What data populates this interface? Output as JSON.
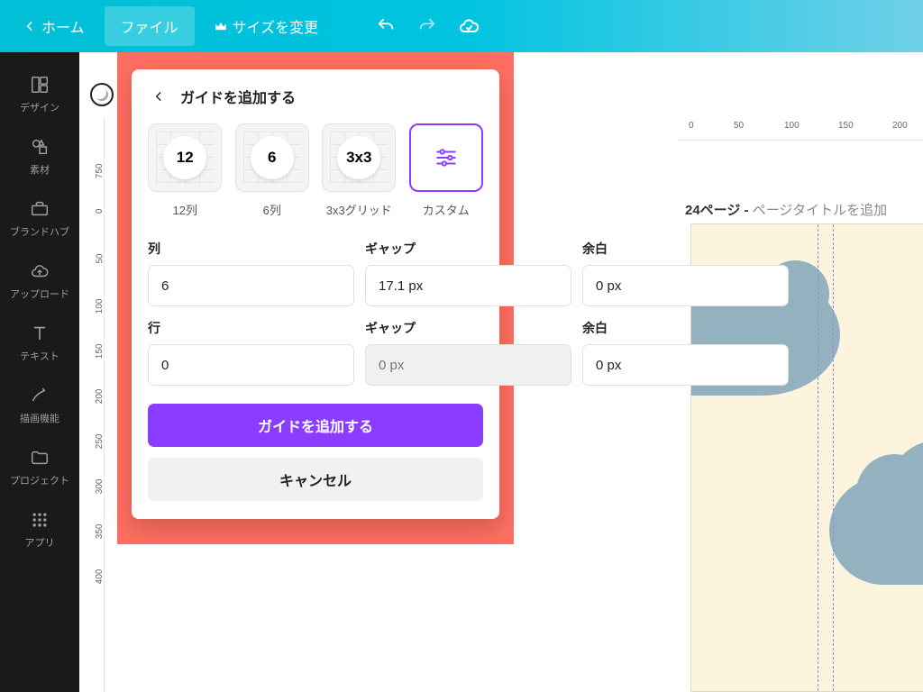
{
  "topbar": {
    "home": "ホーム",
    "file": "ファイル",
    "resize": "サイズを変更"
  },
  "sidebar": {
    "items": [
      {
        "label": "デザイン"
      },
      {
        "label": "素材"
      },
      {
        "label": "ブランドハブ"
      },
      {
        "label": "アップロード"
      },
      {
        "label": "テキスト"
      },
      {
        "label": "描画機能"
      },
      {
        "label": "プロジェクト"
      },
      {
        "label": "アプリ"
      }
    ]
  },
  "ruler": {
    "h": [
      "0",
      "50",
      "100",
      "150",
      "200"
    ],
    "v": [
      "750",
      "0",
      "50",
      "100",
      "150",
      "200",
      "250",
      "300",
      "350",
      "400"
    ]
  },
  "canvas": {
    "page_num": "24ページ",
    "page_sep": " - ",
    "page_title_prompt": "ページタイトルを追加"
  },
  "panel": {
    "title": "ガイドを追加する",
    "presets": [
      {
        "badge": "12",
        "label": "12列"
      },
      {
        "badge": "6",
        "label": "6列"
      },
      {
        "badge": "3x3",
        "label": "3x3グリッド"
      },
      {
        "badge": "",
        "label": "カスタム"
      }
    ],
    "cols": {
      "label": "列",
      "value": "6"
    },
    "cols_gap": {
      "label": "ギャップ",
      "value": "17.1 px"
    },
    "cols_margin": {
      "label": "余白",
      "value": "0 px"
    },
    "rows": {
      "label": "行",
      "value": "0"
    },
    "rows_gap": {
      "label": "ギャップ",
      "placeholder": "0 px"
    },
    "rows_margin": {
      "label": "余白",
      "value": "0 px"
    },
    "primary": "ガイドを追加する",
    "secondary": "キャンセル"
  },
  "colors": {
    "accent": "#8B3DFF",
    "highlight": "#FF6F61"
  }
}
